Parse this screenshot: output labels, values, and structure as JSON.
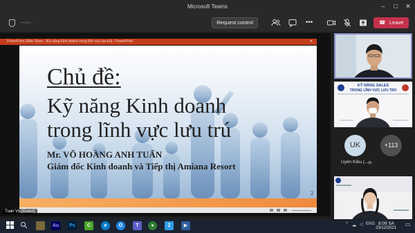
{
  "window": {
    "title": "Microsoft Teams"
  },
  "toolbar": {
    "timer": "--:--",
    "request_control": "Request control",
    "leave_label": "Leave",
    "colors": {
      "leave": "#c4314b",
      "background": "#292929"
    }
  },
  "ppt": {
    "window_caption": "PowerPoint Slide Show - [Kỹ năng Kinh doanh trong lĩnh vực lưu trú] - PowerPoint"
  },
  "slide": {
    "title_line1": "Chủ đề:",
    "title_line2": "Kỹ năng Kinh doanh",
    "title_line3": "trong lĩnh vực lưu trú",
    "speaker": "Mr. VÕ HOÀNG ANH TUẤN",
    "role": "Giám đốc Kinh doanh và Tiếp thị Amiana Resort",
    "page_number": "2",
    "accent": "#ef8a3c"
  },
  "presenter": {
    "name": "Tuan Vo (Guest)"
  },
  "participants": {
    "tile2_banner_line1": "KỸ NĂNG SALES",
    "tile2_banner_line2": "TRONG LĨNH VỰC LƯU TRÚ",
    "avatar1_initials": "UK",
    "avatar1_name": "Uyên Kiều (...",
    "avatar2_label": "+113"
  },
  "taskbar": {
    "time": "8:09 SA",
    "date": "23/12/2021",
    "language": "ENG"
  }
}
